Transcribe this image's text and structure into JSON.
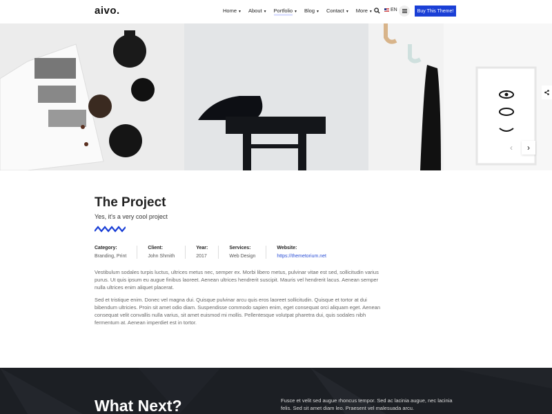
{
  "header": {
    "logo": "aivo.",
    "nav": [
      {
        "label": "Home",
        "has_caret": true
      },
      {
        "label": "About",
        "has_caret": true
      },
      {
        "label": "Portfolio",
        "has_caret": true,
        "active": true
      },
      {
        "label": "Blog",
        "has_caret": true
      },
      {
        "label": "Contact",
        "has_caret": true
      },
      {
        "label": "More",
        "has_caret": true
      }
    ],
    "search_icon": "search-icon",
    "language": "EN",
    "menu_icon": "hamburger-icon",
    "buy_button": "Buy This Theme!"
  },
  "gallery": {
    "prev_icon": "chevron-left-icon",
    "next_icon": "chevron-right-icon",
    "share_icon": "share-icon"
  },
  "project": {
    "title": "The Project",
    "subtitle": "Yes, it's a very cool project",
    "meta": [
      {
        "label": "Category:",
        "value": "Branding, Print"
      },
      {
        "label": "Client:",
        "value": "John Shmith"
      },
      {
        "label": "Year:",
        "value": "2017"
      },
      {
        "label": "Services:",
        "value": "Web Design"
      },
      {
        "label": "Website:",
        "value": "https://themetorium.net"
      }
    ],
    "paragraph1": "Vestibulum sodales turpis luctus, ultrices metus nec, semper ex. Morbi libero metus, pulvinar vitae est sed, sollicitudin varius purus. Ut quis ipsum eu augue finibus laoreet. Aenean ultrices hendrerit suscipit. Mauris vel hendrerit lacus. Aenean semper nulla ultrices enim aliquet placerat.",
    "paragraph2": "Sed et tristique enim. Donec vel magna dui. Quisque pulvinar arcu quis eros laoreet sollicitudin. Quisque et tortor at dui bibendum ultricies. Proin sit amet odio diam. Suspendisse commodo sapien enim, eget consequat orci aliquam eget. Aenean consequat velit convallis nulla varius, sit amet euismod mi mollis. Pellentesque volutpat pharetra dui, quis sodales nibh fermentum at. Aenean imperdiet est in tortor."
  },
  "footer": {
    "title": "What Next?",
    "text": "Fusce et velit sed augue rhoncus tempor. Sed ac lacinia augue, nec lacinia felis. Sed sit amet diam leo. Praesent vel malesuada arcu."
  },
  "colors": {
    "accent": "#1a3fd6",
    "footer_bg": "#1c1f24"
  }
}
